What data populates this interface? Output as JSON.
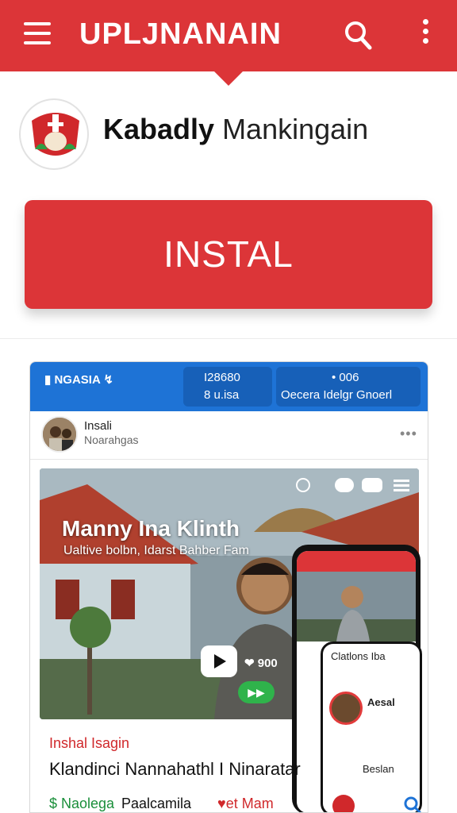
{
  "header": {
    "title": "UPLJNANAIN",
    "menu_icon": "hamburger-icon",
    "search_icon": "search-icon",
    "more_icon": "more-vertical-icon",
    "color": "#dc3538"
  },
  "app": {
    "name_bold": "Kabadly",
    "name_rest": "Mankingain",
    "logo_icon": "app-logo-emblem"
  },
  "install": {
    "label": "INSTAL",
    "color": "#dc3538"
  },
  "preview": {
    "bar": {
      "left_label": "NGASIA",
      "pill1_line1": "I28680",
      "pill1_line2": "8 u.isa",
      "pill2_line1": "• 006",
      "pill2_line2": "Oecera Idelgr Gnoerl",
      "color": "#1e73d6"
    },
    "post": {
      "name": "Insali",
      "subtitle": "Noarahgas",
      "more": "•••"
    },
    "media": {
      "headline": "Manny Ina Klinth",
      "caption": "Ualtive bolbn, Idarst Bahber Fam",
      "count": "❤ 900",
      "play_icon": "play-icon"
    },
    "phone": {
      "card_title": "Clatlons Iba",
      "card_name": "Aesal",
      "row_name": "Beslan"
    },
    "footer": {
      "red_text": "Inshal Isagin",
      "main_text": "Klandinci Nannahathl I Ninaratar",
      "item1": "$ Naolega",
      "item2": "Paalcamila",
      "item3": "♥et Mam"
    }
  }
}
